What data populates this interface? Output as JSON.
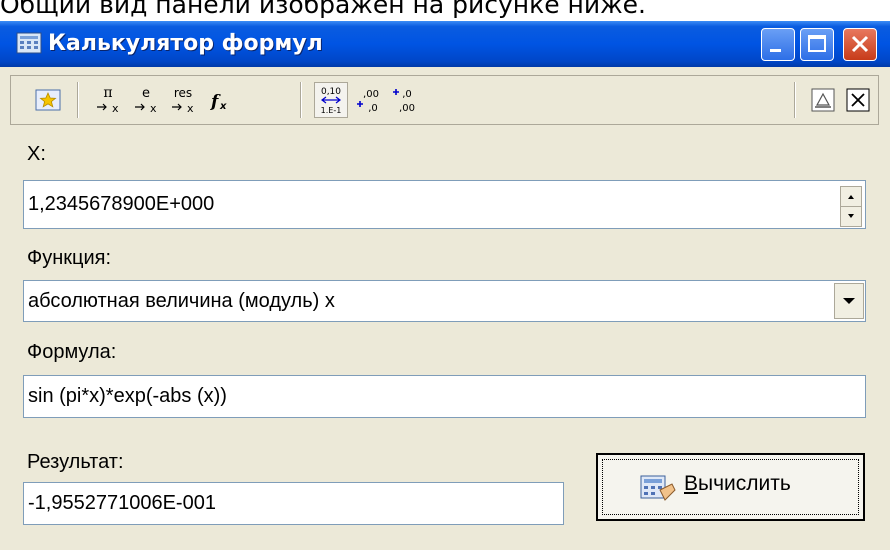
{
  "caption_text": "Общий вид панели изображен на рисунке ниже.",
  "window": {
    "title": "Калькулятор формул"
  },
  "toolbar": {
    "pi_label": "π",
    "e_label": "e",
    "res_label": "res",
    "fx_label": "f",
    "fx_sub": "x",
    "sci_top": "0,10",
    "sci_bottom": "1.E-1",
    "inc_dec_label": ",00",
    "inc_dec_sub": ",0",
    "dec_dec_label": ",0",
    "dec_dec_sub": ",00"
  },
  "x_section": {
    "label": "X:",
    "value": "1,2345678900E+000"
  },
  "function_section": {
    "label": "Функция:",
    "selected": "абсолютная величина (модуль) x"
  },
  "formula_section": {
    "label": "Формула:",
    "value": "sin (pi*x)*exp(-abs (x))"
  },
  "result_section": {
    "label": "Результат:",
    "value": "-1,9552771006E-001"
  },
  "calculate_button": {
    "mnemonic": "В",
    "rest": "ычислить"
  }
}
